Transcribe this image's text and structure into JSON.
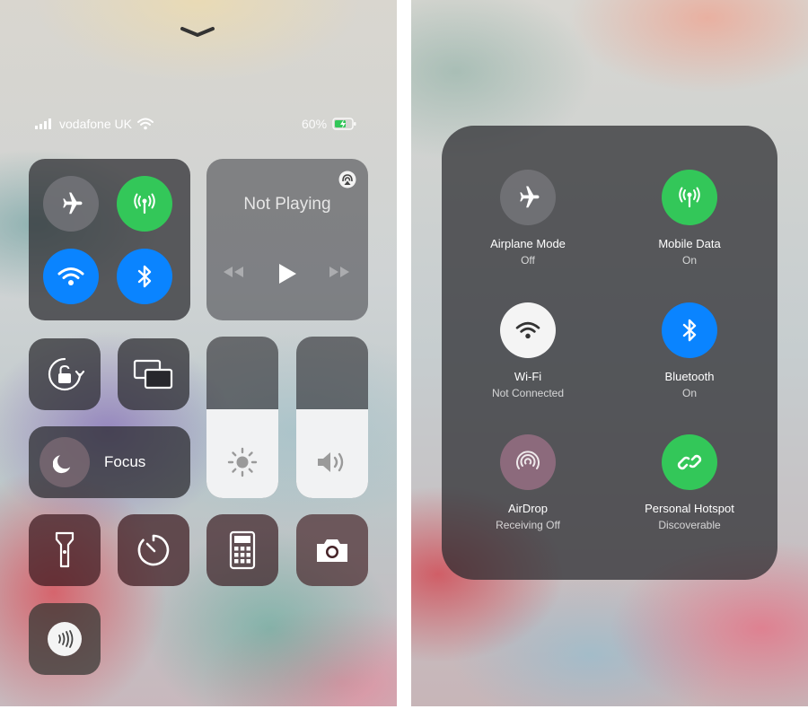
{
  "status_bar": {
    "carrier": "vodafone UK",
    "battery": "60%"
  },
  "now_playing": {
    "title": "Not Playing"
  },
  "focus": {
    "label": "Focus"
  },
  "sliders": {
    "brightness_level": 0.55,
    "volume_level": 0.55
  },
  "connectivity": [
    {
      "label": "Airplane Mode",
      "status": "Off"
    },
    {
      "label": "Mobile Data",
      "status": "On"
    },
    {
      "label": "Wi-Fi",
      "status": "Not Connected"
    },
    {
      "label": "Bluetooth",
      "status": "On"
    },
    {
      "label": "AirDrop",
      "status": "Receiving Off"
    },
    {
      "label": "Personal Hotspot",
      "status": "Discoverable"
    }
  ],
  "colors": {
    "green": "#33c759",
    "blue": "#0a84ff",
    "tile_dark": "#28282d"
  }
}
